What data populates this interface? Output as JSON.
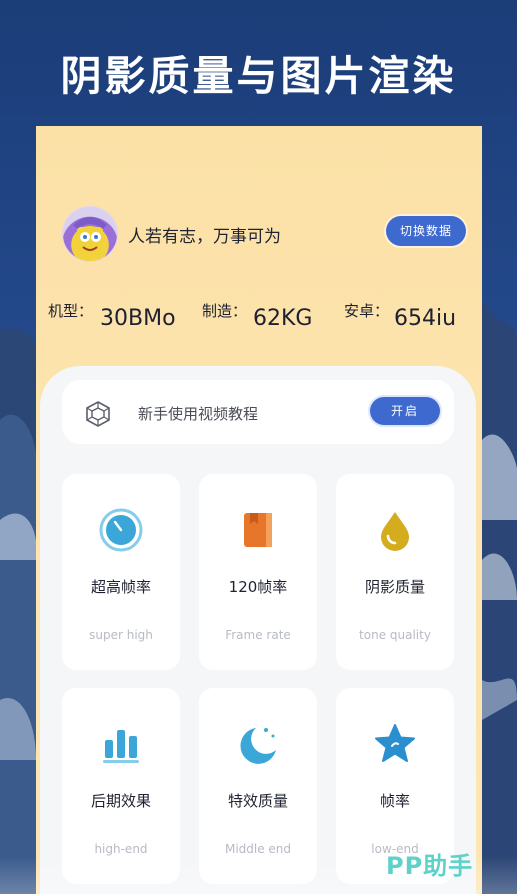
{
  "banner": {
    "title": "阴影质量与图片渲染"
  },
  "profile": {
    "motto": "人若有志，万事可为",
    "switch_label": "切换数据"
  },
  "stats": [
    {
      "label": "机型：",
      "value": "30BMo"
    },
    {
      "label": "制造：",
      "value": "62KG"
    },
    {
      "label": "安卓：",
      "value": "654iu"
    }
  ],
  "tutorial": {
    "label": "新手使用视频教程",
    "button": "开启"
  },
  "features": [
    {
      "name": "超高帧率",
      "sub": "super high",
      "icon": "stopwatch-icon"
    },
    {
      "name": "120帧率",
      "sub": "Frame rate",
      "icon": "book-icon"
    },
    {
      "name": "阴影质量",
      "sub": "tone quality",
      "icon": "droplet-icon"
    },
    {
      "name": "后期效果",
      "sub": "high-end",
      "icon": "bar-chart-icon"
    },
    {
      "name": "特效质量",
      "sub": "Middle end",
      "icon": "moon-icon"
    },
    {
      "name": "帧率",
      "sub": "low-end",
      "icon": "star-icon"
    }
  ],
  "watermark": "PP助手",
  "colors": {
    "accent": "#3e6ad0",
    "icon_blue": "#3aa7d8",
    "icon_orange": "#e8762a",
    "icon_gold": "#d4ac1e",
    "background": "#1b3d78"
  }
}
